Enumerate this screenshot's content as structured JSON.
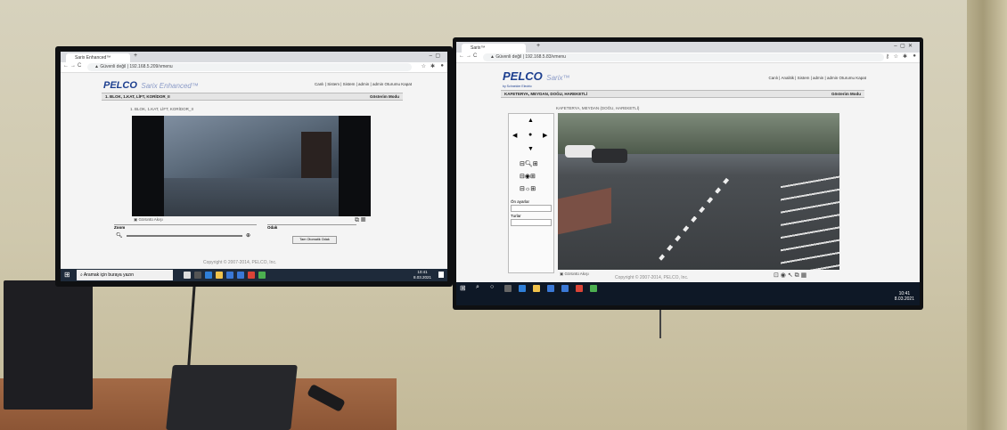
{
  "left_monitor": {
    "tab_title": "Sarix Enhanced™",
    "url_prefix": "Güvenli değil",
    "url": "192.168.5.209/vmenu",
    "logo": "PELCO",
    "product": "Sarix Enhanced™",
    "brand_sub": "by Schneider Electric",
    "links": "Canlı | Sistem | Sistem | admin | admin Oturumu Kapat",
    "breadcrumb": "1. BLOK, 1.KAT, LİFT, KORİDOR_II",
    "compress_mode": "Gösterim Modu",
    "camera_caption": "1. BLOK, 1.KAT, LİFT, KORİDOR_II",
    "snapshot_label": "Görüntü Akışı",
    "zoom_label": "Zoom",
    "focus_label": "Odak",
    "focus_button": "Tam Otomatik Odak",
    "copyright": "Copyright © 2007-2014, PELCO, Inc.",
    "search": "Aramak için buraya yazın",
    "time": "10:41",
    "date": "8.03.2021"
  },
  "right_monitor": {
    "tab_title": "Sarix™",
    "url_prefix": "Güvenli değil",
    "url": "192.168.5.83/vmenu",
    "logo": "PELCO",
    "product": "Sarix™",
    "brand_sub": "by Schneider Electric",
    "links": "Canlı | Analitik | Sistem | admin | admin Oturumu Kapat",
    "breadcrumb": "KAFETERYA, MEYDAN, DOĞU, HAREKETLİ",
    "compress_mode": "Gösterim Modu",
    "camera_caption": "KAFETERYA, MEYDAN (DOĞU, HAREKETLİ)",
    "preset_label": "Ön ayarlar",
    "tour_label": "Turlar",
    "snapshot_label": "Görüntü Akışı",
    "copyright": "Copyright © 2007-2014, PELCO, Inc.",
    "time": "10:41",
    "date": "8.03.2021"
  }
}
